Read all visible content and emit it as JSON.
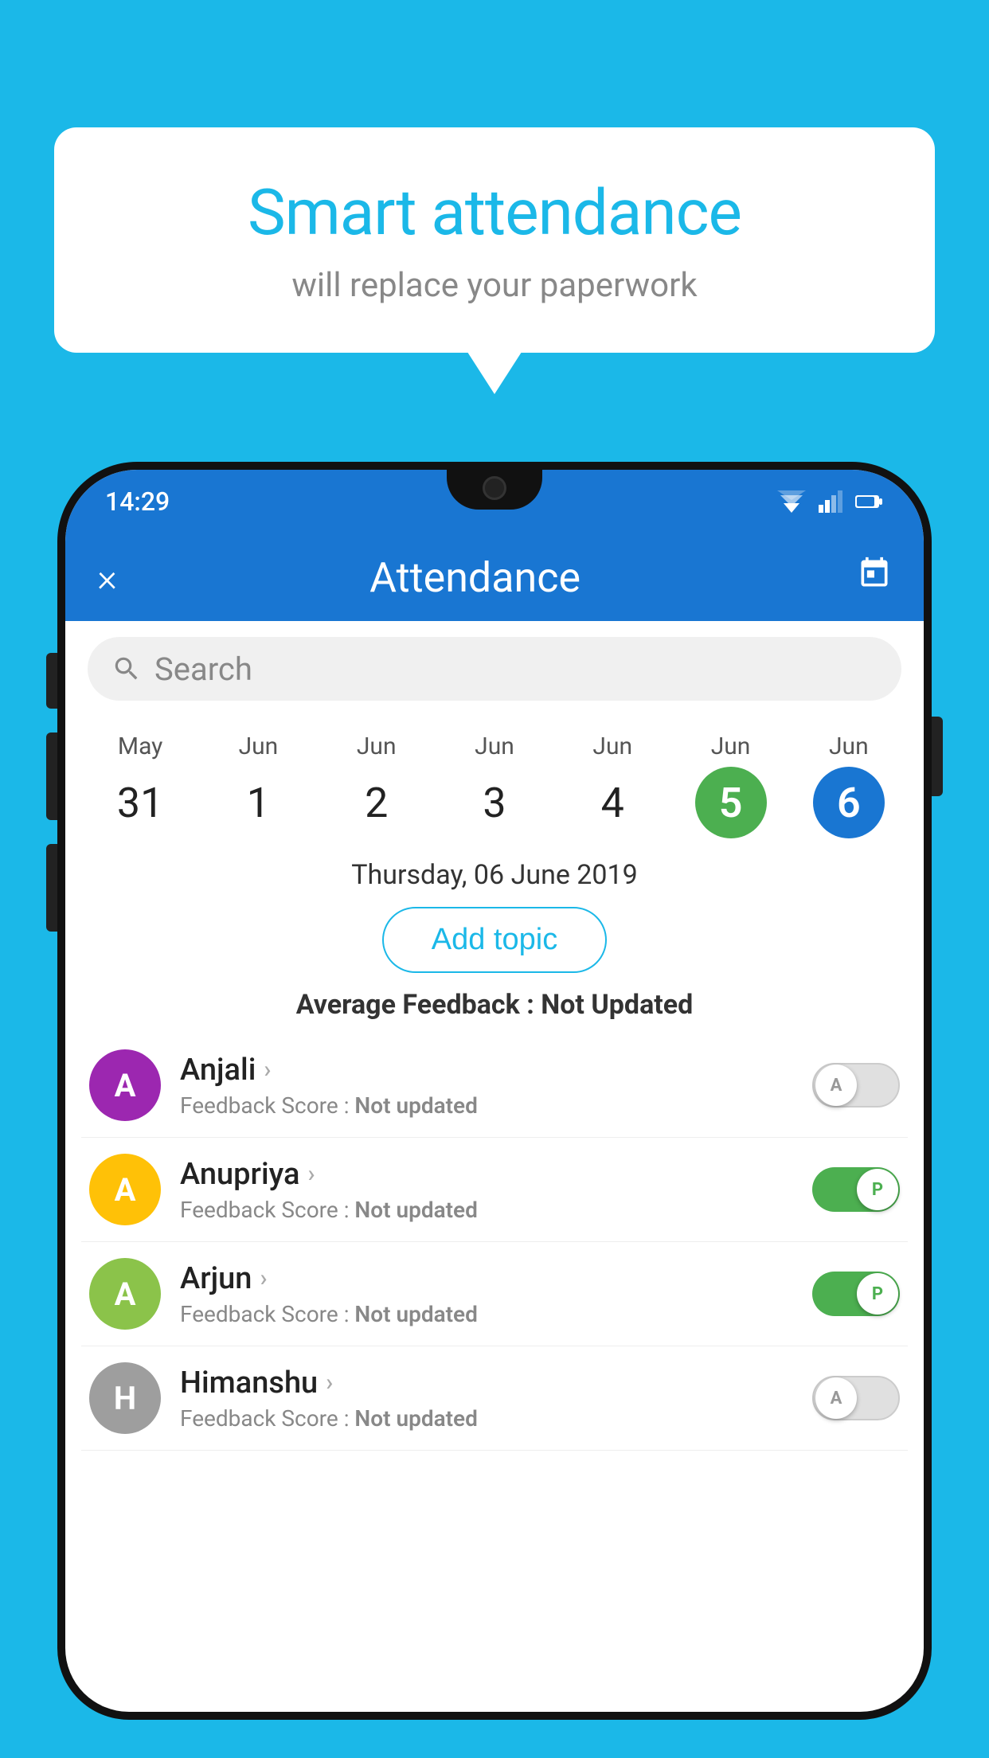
{
  "app": {
    "background_color": "#1BB8E8"
  },
  "bubble": {
    "title": "Smart attendance",
    "subtitle": "will replace your paperwork"
  },
  "status_bar": {
    "time": "14:29"
  },
  "header": {
    "title": "Attendance",
    "close_label": "×"
  },
  "search": {
    "placeholder": "Search"
  },
  "calendar": {
    "days": [
      {
        "month": "May",
        "date": "31",
        "type": "normal"
      },
      {
        "month": "Jun",
        "date": "1",
        "type": "normal"
      },
      {
        "month": "Jun",
        "date": "2",
        "type": "normal"
      },
      {
        "month": "Jun",
        "date": "3",
        "type": "normal"
      },
      {
        "month": "Jun",
        "date": "4",
        "type": "normal"
      },
      {
        "month": "Jun",
        "date": "5",
        "type": "today"
      },
      {
        "month": "Jun",
        "date": "6",
        "type": "selected"
      }
    ],
    "selected_date_label": "Thursday, 06 June 2019"
  },
  "add_topic": {
    "label": "Add topic"
  },
  "avg_feedback": {
    "label": "Average Feedback :",
    "value": "Not Updated"
  },
  "students": [
    {
      "name": "Anjali",
      "feedback_label": "Feedback Score :",
      "feedback_value": "Not updated",
      "avatar_letter": "A",
      "avatar_color": "#9C27B0",
      "attendance": "absent"
    },
    {
      "name": "Anupriya",
      "feedback_label": "Feedback Score :",
      "feedback_value": "Not updated",
      "avatar_letter": "A",
      "avatar_color": "#FFC107",
      "attendance": "present"
    },
    {
      "name": "Arjun",
      "feedback_label": "Feedback Score :",
      "feedback_value": "Not updated",
      "avatar_letter": "A",
      "avatar_color": "#8BC34A",
      "attendance": "present"
    },
    {
      "name": "Himanshu",
      "feedback_label": "Feedback Score :",
      "feedback_value": "Not updated",
      "avatar_letter": "H",
      "avatar_color": "#9E9E9E",
      "attendance": "absent"
    }
  ]
}
